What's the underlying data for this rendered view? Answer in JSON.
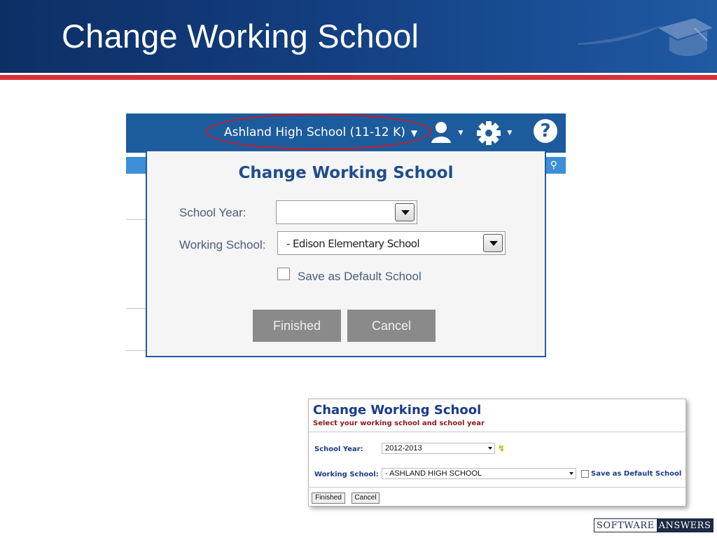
{
  "slide": {
    "title": "Change Working School"
  },
  "new_ui": {
    "navbar": {
      "school_selector": "Ashland High School  (11-12 K)",
      "help_label": "?"
    },
    "dialog": {
      "title": "Change Working School",
      "school_year_label": "School Year:",
      "school_year_value": "",
      "working_school_label": "Working School:",
      "working_school_value": "- Edison Elementary School",
      "save_default_label": "Save as Default School",
      "save_default_checked": false,
      "finished_button": "Finished",
      "cancel_button": "Cancel"
    }
  },
  "old_ui": {
    "title": "Change Working School",
    "subtitle": "Select your working school and school year",
    "school_year_label": "School Year:",
    "school_year_value": "2012-2013",
    "working_school_label": "Working School:",
    "working_school_value": "- ASHLAND HIGH SCHOOL",
    "save_default_label": "Save as Default School",
    "save_default_checked": false,
    "finished_button": "Finished",
    "cancel_button": "Cancel"
  },
  "branding": {
    "logo_left": "SOFTWARE",
    "logo_right": "ANSWERS"
  },
  "colors": {
    "header_blue": "#123c7c",
    "header_red_rule": "#d8303a",
    "navbar_blue": "#1d5c9c",
    "annotation_red": "#d9141e",
    "dialog_title_blue": "#1f4e8a",
    "old_ui_label_blue": "#1a3b8c",
    "old_ui_subtitle_red": "#8b1a1a"
  },
  "icons": {
    "user_menu": "user-icon",
    "settings_menu": "gear-icon",
    "help": "help-icon",
    "search": "search-icon",
    "quick_set": "lightning-icon",
    "logo": "graduation-cap-logo"
  }
}
